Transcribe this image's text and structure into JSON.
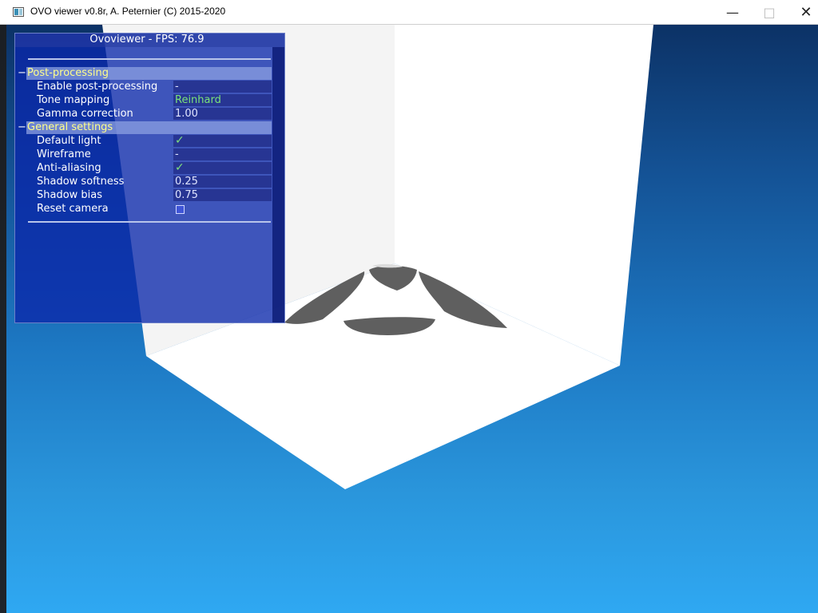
{
  "window": {
    "title": "OVO viewer v0.8r, A. Peternier (C) 2015-2020",
    "buttons": {
      "minimize": "—",
      "maximize": "□",
      "close": "✕"
    }
  },
  "panel": {
    "title": "Ovoviewer - FPS: 76.9",
    "sections": [
      {
        "label": "Post-processing",
        "toggle": "−",
        "items": [
          {
            "label": "Enable post-processing",
            "value": "-"
          },
          {
            "label": "Tone mapping",
            "value": "Reinhard"
          },
          {
            "label": "Gamma correction",
            "value": "1.00"
          }
        ]
      },
      {
        "label": "General settings",
        "toggle": "−",
        "items": [
          {
            "label": "Default light",
            "value": "✓",
            "checked": true
          },
          {
            "label": "Wireframe",
            "value": "-"
          },
          {
            "label": "Anti-aliasing",
            "value": "✓",
            "checked": true
          },
          {
            "label": "Shadow softness",
            "value": "0.25"
          },
          {
            "label": "Shadow bias",
            "value": "0.75"
          },
          {
            "label": "Reset camera",
            "value": ""
          }
        ]
      }
    ]
  },
  "colors": {
    "section_header_text": "#ffff8a",
    "check": "#7ee07e",
    "tone_mapping_value": "#7ae27a",
    "sky_top": "#0c3266",
    "sky_bottom": "#2fa8f2",
    "shadow": "#5f5f5f"
  }
}
